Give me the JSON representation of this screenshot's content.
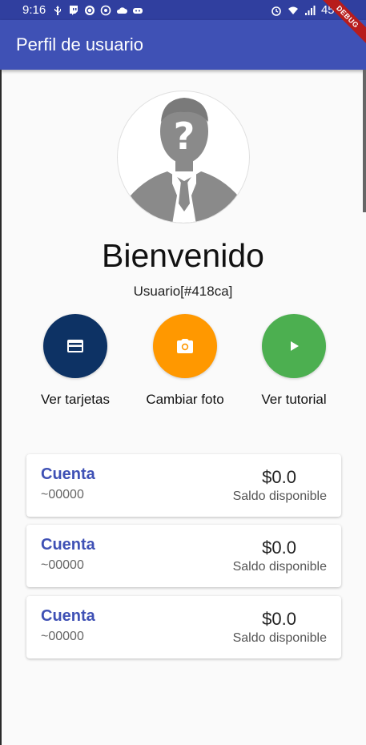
{
  "status_bar": {
    "time": "9:16",
    "battery": "45%"
  },
  "app_bar": {
    "title": "Perfil de usuario"
  },
  "debug_banner": "DEBUG",
  "profile": {
    "welcome": "Bienvenido",
    "user_id": "Usuario[#418ca]"
  },
  "actions": [
    {
      "label": "Ver tarjetas",
      "icon": "credit-card-icon",
      "color": "#0d3264"
    },
    {
      "label": "Cambiar foto",
      "icon": "camera-icon",
      "color": "#ff9800"
    },
    {
      "label": "Ver tutorial",
      "icon": "play-icon",
      "color": "#4caf50"
    }
  ],
  "accounts": [
    {
      "title": "Cuenta",
      "number": "~00000",
      "balance": "$0.0",
      "caption": "Saldo disponible"
    },
    {
      "title": "Cuenta",
      "number": "~00000",
      "balance": "$0.0",
      "caption": "Saldo disponible"
    },
    {
      "title": "Cuenta",
      "number": "~00000",
      "balance": "$0.0",
      "caption": "Saldo disponible"
    }
  ],
  "colors": {
    "primary": "#3f51b5",
    "primary_dark": "#303f9f"
  }
}
